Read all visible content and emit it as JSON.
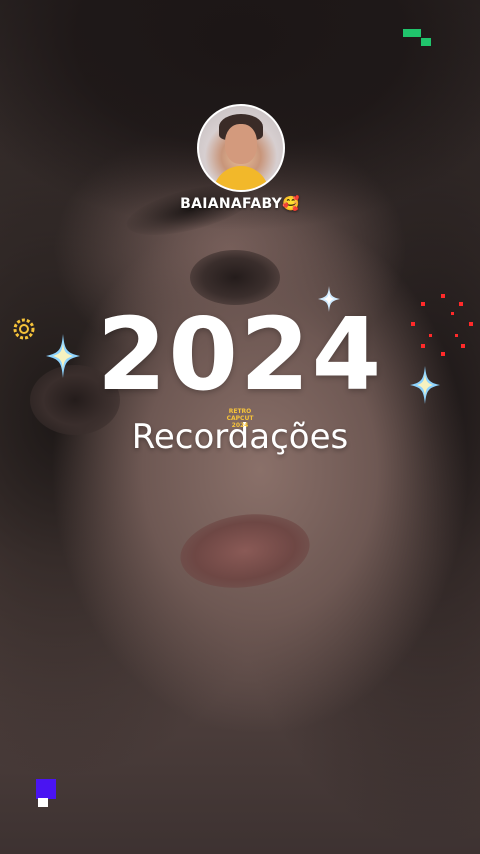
{
  "profile": {
    "username": "BAIANAFABY🥰"
  },
  "headline": {
    "year": "2024",
    "subtitle": "Recordações"
  },
  "watermark": {
    "lines": [
      "RETRO",
      "CAPCUT",
      "2024"
    ]
  },
  "colors": {
    "accent_green": "#20c46c",
    "accent_purple": "#4a14f2",
    "sparkle_blue": "#8fd4ff",
    "sparkle_gold": "#f6c33a",
    "firework_red": "#ff2a2a"
  },
  "icons": {
    "sparkles": "four-point-star-icon",
    "ring": "sun-ring-icon",
    "fireworks": "firework-burst-icon"
  }
}
